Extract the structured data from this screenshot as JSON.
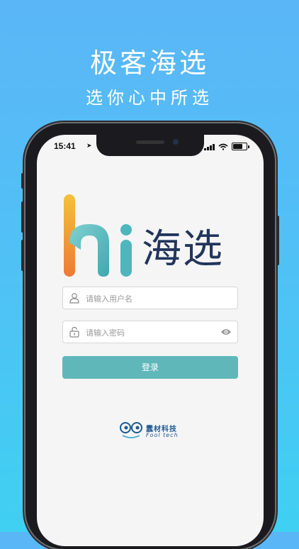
{
  "hero": {
    "title": "极客海选",
    "subtitle": "选你心中所选"
  },
  "status_bar": {
    "time": "15:41"
  },
  "logo": {
    "text": "海选"
  },
  "form": {
    "username_placeholder": "请输入用户名",
    "password_placeholder": "请输入密码",
    "login_label": "登录"
  },
  "brand": {
    "name_cn": "蠢材科技",
    "name_en": "Fool tech"
  },
  "colors": {
    "background_top": "#5bb6f7",
    "background_bottom": "#3fd0f2",
    "button": "#5fb7b9",
    "logo_text": "#22355c",
    "brand": "#1d5a93"
  }
}
